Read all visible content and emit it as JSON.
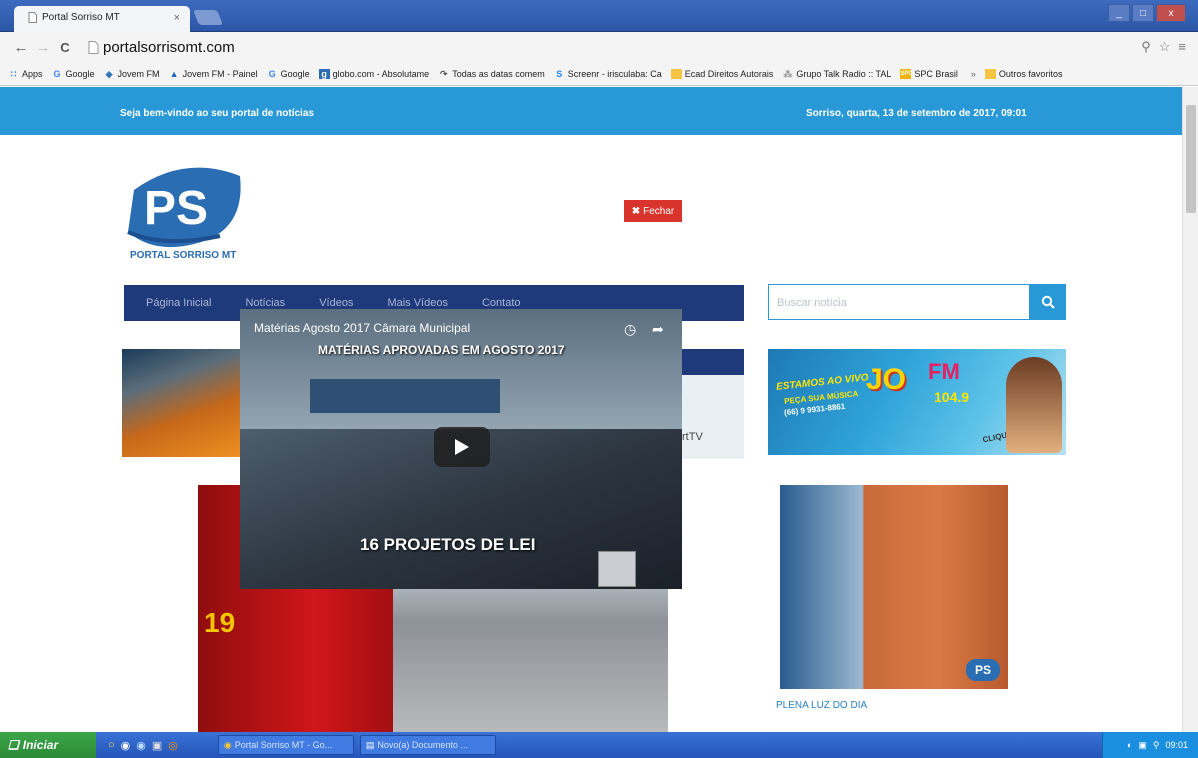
{
  "browser": {
    "tab_title": "Portal Sorriso MT",
    "tab_close": "×",
    "address": "portalsorrisomt.com",
    "window_controls": [
      "_",
      "□",
      "x"
    ],
    "nav": {
      "back": "←",
      "forward": "→",
      "reload": "C"
    },
    "toolbar_icons": [
      "zoom-icon",
      "star-icon",
      "menu-icon"
    ]
  },
  "bookmarks": [
    {
      "label": "Apps",
      "icon": "apps-grid-icon"
    },
    {
      "label": "Google",
      "icon": "google-icon"
    },
    {
      "label": "Jovem FM",
      "icon": "bookmark-icon"
    },
    {
      "label": "Jovem FM - Painel",
      "icon": "bookmark-icon"
    },
    {
      "label": "Google",
      "icon": "google-icon"
    },
    {
      "label": "globo.com - Absolutame",
      "icon": "globo-icon"
    },
    {
      "label": "Todas as datas comem",
      "icon": "bookmark-icon"
    },
    {
      "label": "Screenr - irisculaba: Ca",
      "icon": "screenr-icon"
    },
    {
      "label": "Ecad Direitos Autorais",
      "icon": "folder-icon"
    },
    {
      "label": "Grupo Talk Radio :: TAL",
      "icon": "bookmark-icon"
    },
    {
      "label": "SPC Brasil",
      "icon": "spc-icon"
    }
  ],
  "bookmarks_more": "»",
  "bookmarks_other": "Outros favoritos",
  "site": {
    "welcome": "Seja bem-vindo ao seu portal de notícias",
    "date": "Sorriso, quarta, 13 de setembro de 2017, 09:01",
    "logo_letters": "PS",
    "logo_name": "PORTAL SORRISO MT",
    "nav": [
      "Página Inicial",
      "Notícias",
      "Vídeos",
      "Mais Vídeos",
      "Contato"
    ],
    "search_placeholder": "Buscar notícia",
    "card_label": "rtTV",
    "radio_ad": {
      "line1": "ESTAMOS AO VIVO",
      "line2": "PEÇA SUA MÚSICA",
      "line3": "(66) 9 9931-8861",
      "brand": "JO",
      "fm": "FM",
      "freq": "104.9",
      "cta": "CLIQUE E OUÇA"
    },
    "engine_number": "19",
    "door_caption": "PLENA LUZ DO DIA",
    "door_badge": "PS"
  },
  "video_popup": {
    "title": "Matérias Agosto 2017 Câmara Municipal",
    "headline": "MATÉRIAS APROVADAS EM AGOSTO 2017",
    "subtitle": "16 PROJETOS DE LEI",
    "close_label": "Fechar"
  },
  "taskbar": {
    "start": "Iniciar",
    "tasks": [
      {
        "label": "Portal Sorriso MT - Go...",
        "icon": "chrome-icon"
      },
      {
        "label": "Novo(a) Documento ...",
        "icon": "document-icon"
      }
    ],
    "clock": "09:01"
  },
  "colors": {
    "site_blue": "#2899d6",
    "nav_navy": "#1f3a7a",
    "close_red": "#d9342b",
    "taskbar_blue": "#2456b8"
  }
}
